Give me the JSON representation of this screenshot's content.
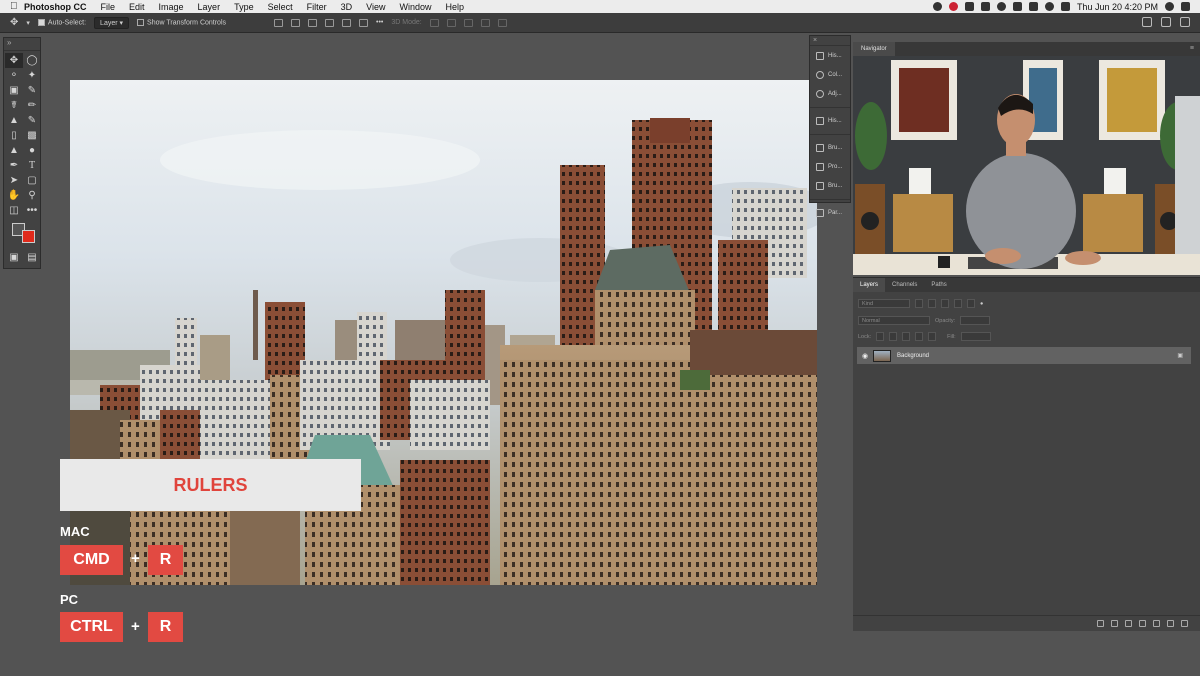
{
  "menubar": {
    "app": "Photoshop CC",
    "items": [
      "File",
      "Edit",
      "Image",
      "Layer",
      "Type",
      "Select",
      "Filter",
      "3D",
      "View",
      "Window",
      "Help"
    ],
    "clock": "Thu Jun 20  4:20 PM"
  },
  "options": {
    "auto_select_label": "Auto-Select:",
    "auto_select_value": "Layer",
    "transform_label": "Show Transform Controls",
    "mode_label": "3D Mode:"
  },
  "panels": {
    "strip": [
      "His...",
      "Col...",
      "Adj...",
      "His...",
      "Bru...",
      "Pro...",
      "Bru...",
      "Par..."
    ],
    "navigator_tab": "Navigator",
    "layers_tabs": [
      "Layers",
      "Channels",
      "Paths"
    ],
    "kind_label": "Kind",
    "blend_mode": "Normal",
    "opacity_label": "Opacity:",
    "lock_label": "Lock:",
    "fill_label": "Fill:",
    "layer_name": "Background"
  },
  "overlay": {
    "title": "RULERS",
    "mac_label": "MAC",
    "mac_key1": "CMD",
    "mac_plus": "+",
    "mac_key2": "R",
    "pc_label": "PC",
    "pc_key1": "CTRL",
    "pc_plus": "+",
    "pc_key2": "R"
  },
  "colors": {
    "accent": "#e24a42",
    "background_swatch": "#e12a1b"
  }
}
